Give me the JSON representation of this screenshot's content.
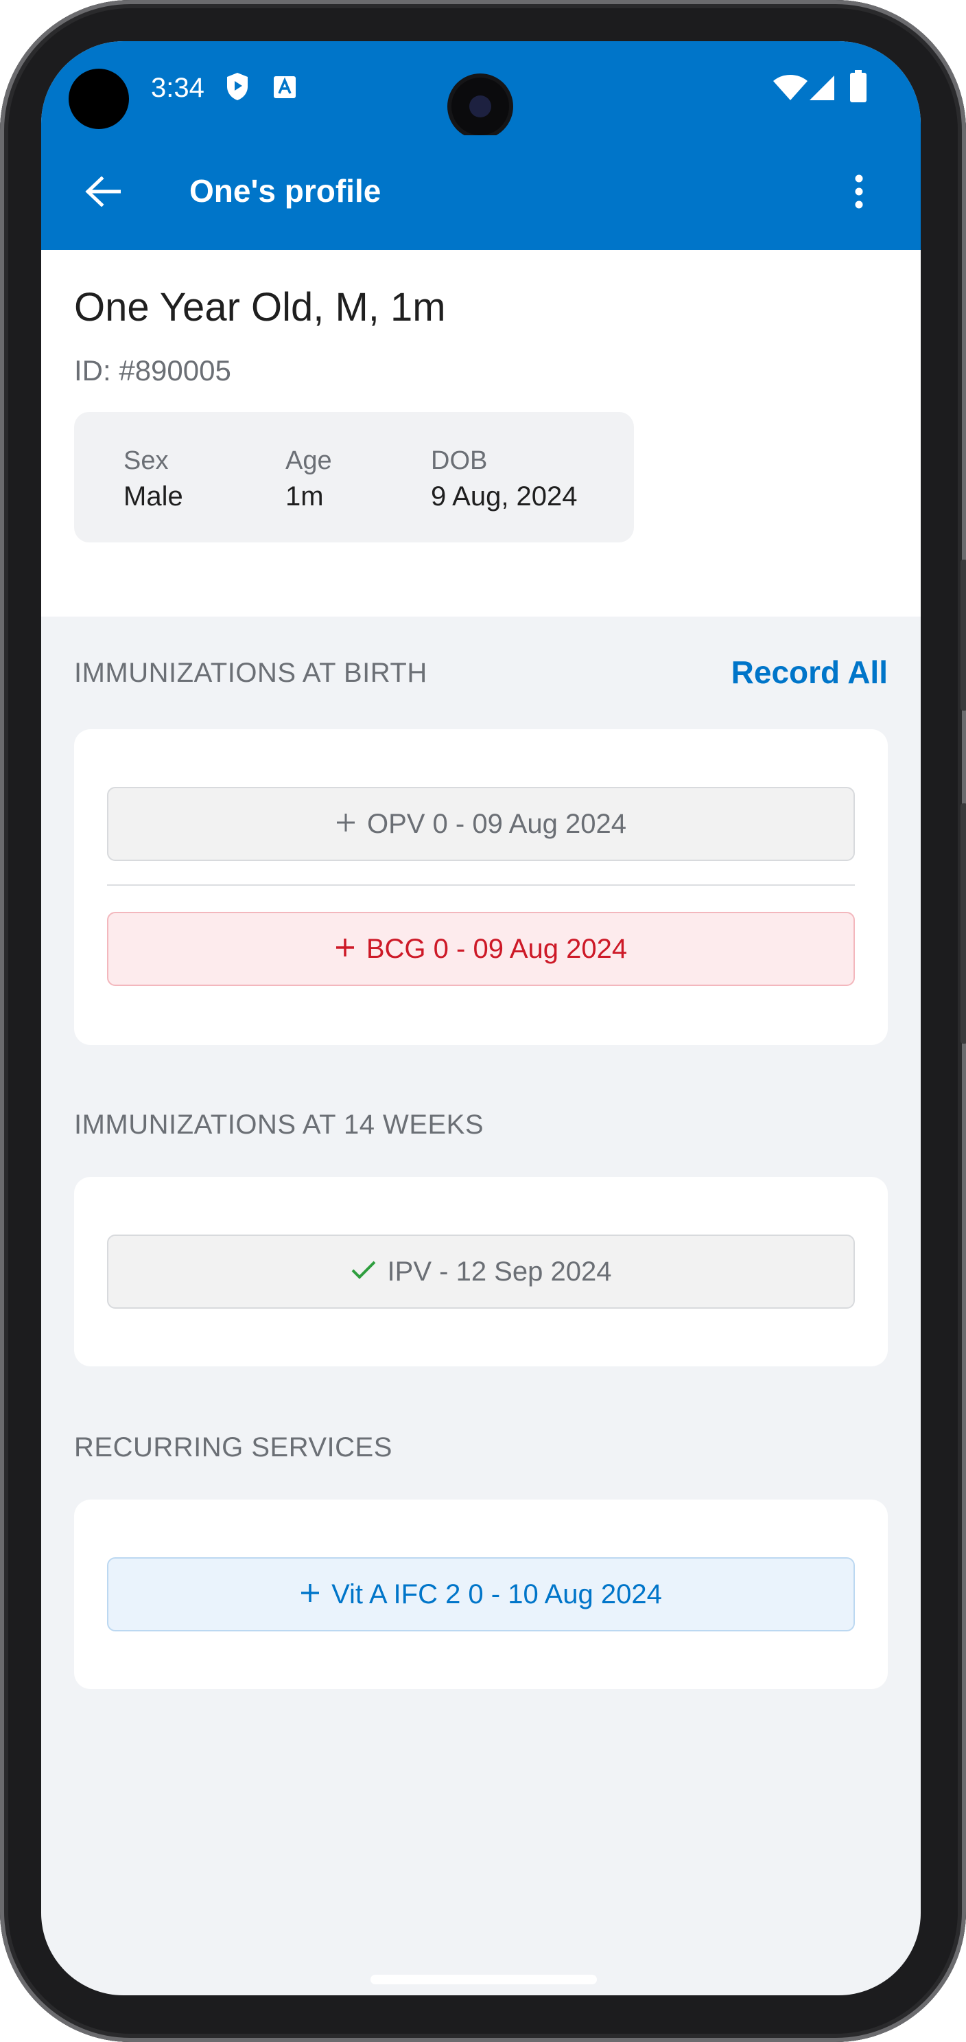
{
  "status_bar": {
    "time": "3:34",
    "icons": [
      "shield-play-icon",
      "text-a-icon",
      "wifi-icon",
      "signal-icon",
      "battery-icon"
    ]
  },
  "top_bar": {
    "title": "One's profile",
    "back_icon": "arrow-left-icon",
    "menu_icon": "more-vertical-icon"
  },
  "profile": {
    "name": "One Year Old, M, 1m",
    "id": "ID: #890005",
    "sex_label": "Sex",
    "sex_value": "Male",
    "age_label": "Age",
    "age_value": "1m",
    "dob_label": "DOB",
    "dob_value": "9 Aug, 2024"
  },
  "sections": {
    "birth": {
      "title": "IMMUNIZATIONS AT BIRTH",
      "record_all": "Record All",
      "items": [
        {
          "label": "OPV 0 - 09 Aug 2024",
          "icon": "plus-icon",
          "status": "neutral"
        },
        {
          "label": "BCG 0 - 09 Aug 2024",
          "icon": "plus-icon",
          "status": "overdue"
        }
      ]
    },
    "weeks14": {
      "title": "IMMUNIZATIONS AT 14 WEEKS",
      "items": [
        {
          "label": "IPV - 12 Sep 2024",
          "icon": "check-icon",
          "status": "done"
        }
      ]
    },
    "recurring": {
      "title": "RECURRING SERVICES",
      "items": [
        {
          "label": "Vit A IFC 2 0 - 10 Aug 2024",
          "icon": "plus-icon",
          "status": "due"
        }
      ]
    }
  },
  "colors": {
    "brand": "#0075c9",
    "overdue": "#cd1927",
    "done": "#2e9e3e",
    "muted": "#6b6f75"
  }
}
